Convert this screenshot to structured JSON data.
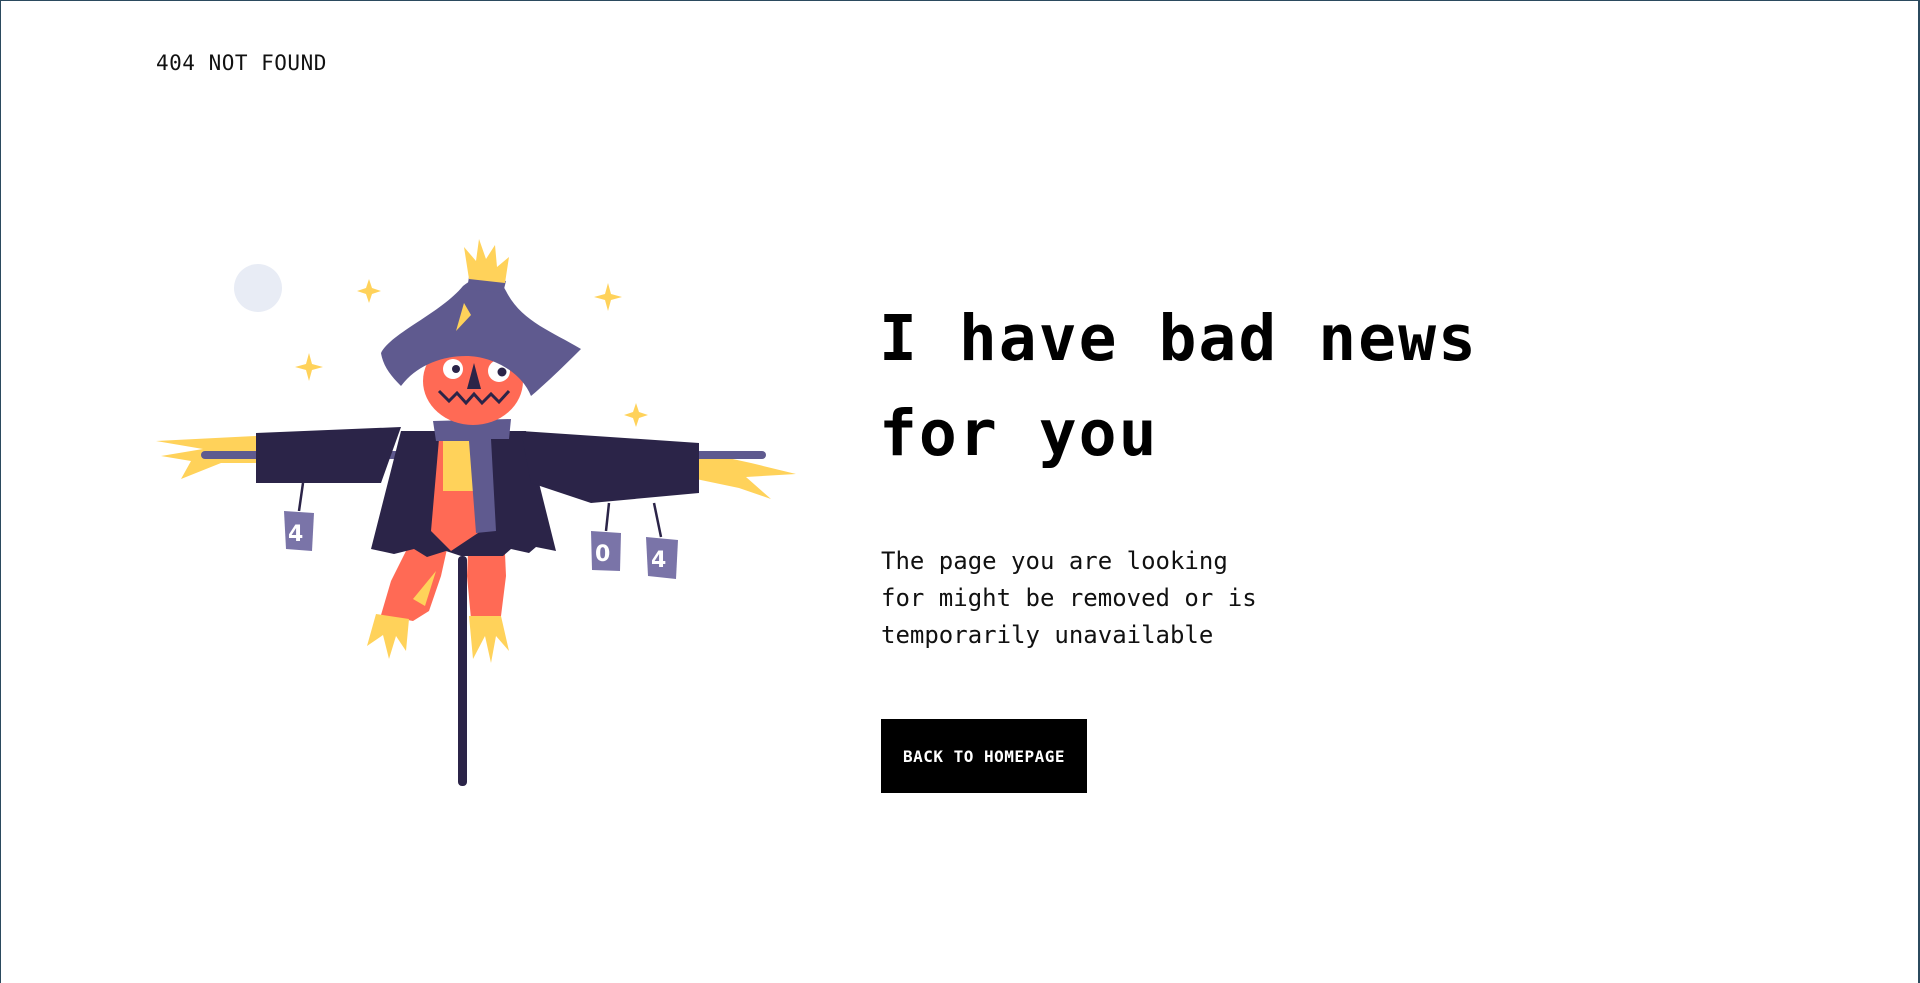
{
  "header": {
    "brand_label": "404 NOT FOUND"
  },
  "main": {
    "headline_line1": "I have bad news",
    "headline_line2": "for you",
    "description_line1": "The page you are looking",
    "description_line2": "for might be removed or is",
    "description_line3": "temporarily unavailable",
    "cta_label": "BACK TO HOMEPAGE"
  },
  "illustration": {
    "can_1": "4",
    "can_2": "0",
    "can_3": "4"
  },
  "colors": {
    "ink": "#000000",
    "jacket": "#2b2448",
    "hat": "#5f5a8f",
    "pumpkin": "#ff6a55",
    "straw": "#ffd25a",
    "moon": "#e8ecf5",
    "frame": "#2b4a5e"
  }
}
